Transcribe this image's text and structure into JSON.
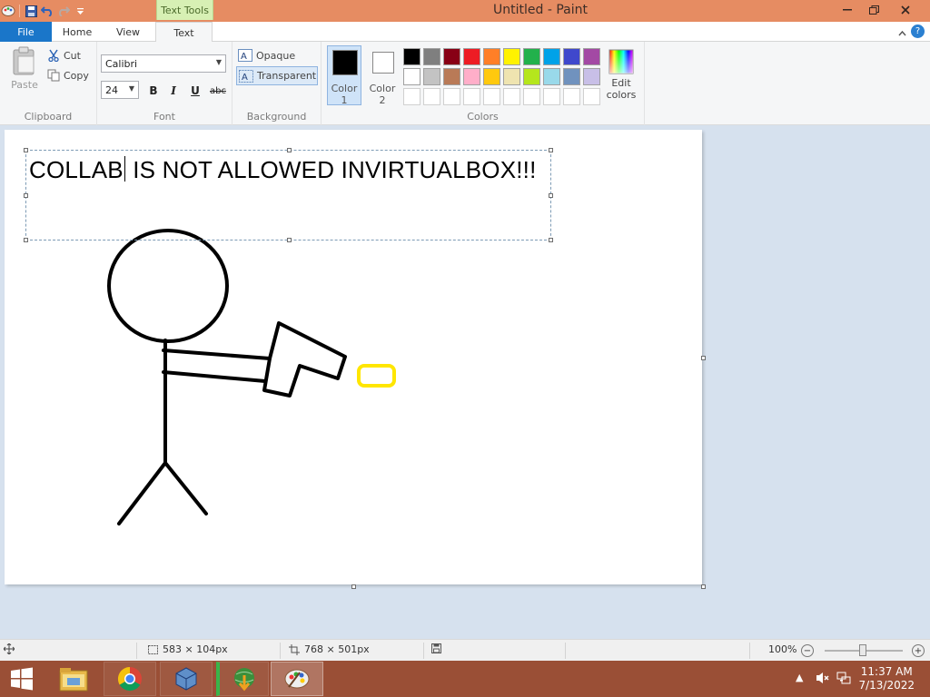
{
  "window": {
    "title": "Untitled - Paint",
    "context_tab": "Text Tools"
  },
  "tabs": {
    "file": "File",
    "home": "Home",
    "view": "View",
    "text": "Text"
  },
  "clipboard": {
    "paste": "Paste",
    "cut": "Cut",
    "copy": "Copy",
    "label": "Clipboard"
  },
  "font": {
    "family": "Calibri",
    "size": "24",
    "bold": "B",
    "italic": "I",
    "underline": "U",
    "strike": "abc",
    "label": "Font"
  },
  "background": {
    "opaque": "Opaque",
    "transparent": "Transparent",
    "label": "Background"
  },
  "colors": {
    "color1": "Color 1",
    "color2": "Color 2",
    "edit": "Edit colors",
    "label": "Colors",
    "color1_value": "#000000",
    "color2_value": "#ffffff",
    "palette": [
      "#000000",
      "#7f7f7f",
      "#880015",
      "#ed1c24",
      "#ff7f27",
      "#fff200",
      "#22b14c",
      "#00a2e8",
      "#3f48cc",
      "#a349a4",
      "#ffffff",
      "#c3c3c3",
      "#b97a57",
      "#ffaec9",
      "#ffc90e",
      "#efe4b0",
      "#b5e61d",
      "#99d9ea",
      "#7092be",
      "#c8bfe7"
    ]
  },
  "canvas": {
    "text": "COLLAB IS NOT ALLOWED INVIRTUALBOX!!!",
    "text_before_caret": "COLLAB",
    "text_after_caret": " IS NOT ALLOWED INVIRTUALBOX!!!",
    "shape_color": "#000000",
    "highlight_color": "#ffe600"
  },
  "status": {
    "selection_size": "583 × 104px",
    "canvas_size": "768 × 501px",
    "zoom": "100%"
  },
  "taskbar": {
    "time": "11:37 AM",
    "date": "7/13/2022"
  }
}
